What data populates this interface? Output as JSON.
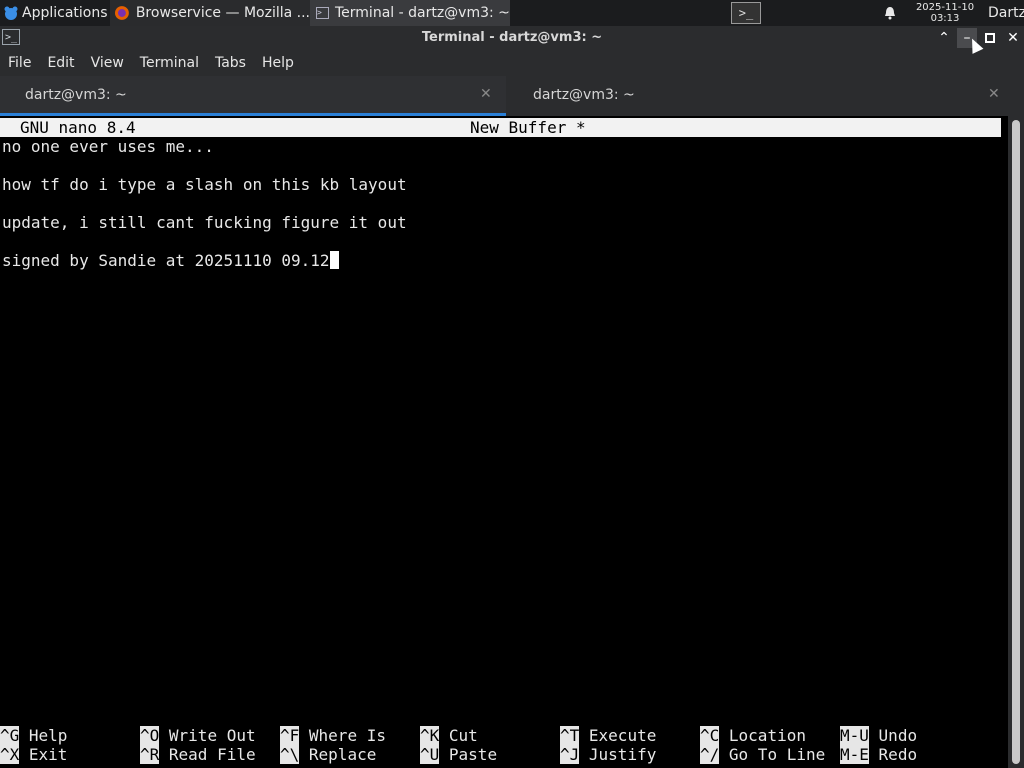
{
  "panel": {
    "applications_label": "Applications",
    "tasks": [
      {
        "label": "Browservice — Mozilla ...",
        "icon": "firefox-icon"
      },
      {
        "label": "Terminal - dartz@vm3: ~",
        "icon": "terminal-icon"
      }
    ],
    "clock_date": "2025-11-10",
    "clock_time": "03:13",
    "user": "Dartz"
  },
  "window": {
    "title": "Terminal - dartz@vm3: ~"
  },
  "menubar": [
    "File",
    "Edit",
    "View",
    "Terminal",
    "Tabs",
    "Help"
  ],
  "tabs": [
    {
      "label": "dartz@vm3: ~",
      "active": true
    },
    {
      "label": "dartz@vm3: ~",
      "active": false
    }
  ],
  "nano": {
    "version": "GNU nano 8.4",
    "buffer": "New Buffer *",
    "lines": [
      "no one ever uses me...",
      "",
      "how tf do i type a slash on this kb layout",
      "",
      "update, i still cant fucking figure it out",
      "",
      "signed by Sandie at 20251110 09.12"
    ],
    "shortcuts": [
      {
        "key": "^G",
        "label": "Help"
      },
      {
        "key": "^O",
        "label": "Write Out"
      },
      {
        "key": "^F",
        "label": "Where Is"
      },
      {
        "key": "^K",
        "label": "Cut"
      },
      {
        "key": "^T",
        "label": "Execute"
      },
      {
        "key": "^C",
        "label": "Location"
      },
      {
        "key": "M-U",
        "label": "Undo"
      },
      {
        "key": "^X",
        "label": "Exit"
      },
      {
        "key": "^R",
        "label": "Read File"
      },
      {
        "key": "^\\",
        "label": "Replace"
      },
      {
        "key": "^U",
        "label": "Paste"
      },
      {
        "key": "^J",
        "label": "Justify"
      },
      {
        "key": "^/",
        "label": "Go To Line"
      },
      {
        "key": "M-E",
        "label": "Redo"
      }
    ]
  },
  "colors": {
    "panel_bg": "#1b1c1e",
    "chrome_bg": "#2b2c2e",
    "tab_accent": "#2a7fd6",
    "terminal_bg": "#000000",
    "terminal_fg": "#e8e8e8"
  }
}
